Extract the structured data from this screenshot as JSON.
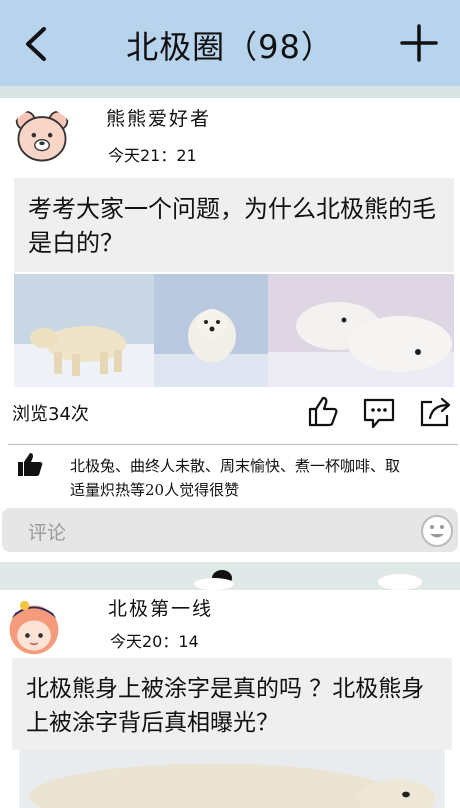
{
  "header": {
    "title": "北极圈（98）",
    "back_icon": "chevron-left-icon",
    "add_icon": "plus-icon"
  },
  "posts": [
    {
      "user": "熊熊爱好者",
      "time": "今天21：21",
      "question": "考考大家一个问题，为什么北极熊的毛是白的？",
      "views": "浏览34次",
      "likes_text": "北极兔、曲终人未散、周末愉快、煮一杯咖啡、取适量炽热等20人觉得很赞",
      "comment_placeholder": "评论"
    },
    {
      "user": "北极第一线",
      "time": "今天20：14",
      "question": "北极熊身上被涂字是真的吗 ？北极熊身上被涂字背后真相曝光？"
    }
  ],
  "colors": {
    "header": "#b8d3ec",
    "card": "#ffffff",
    "question_bg": "#efefef"
  }
}
